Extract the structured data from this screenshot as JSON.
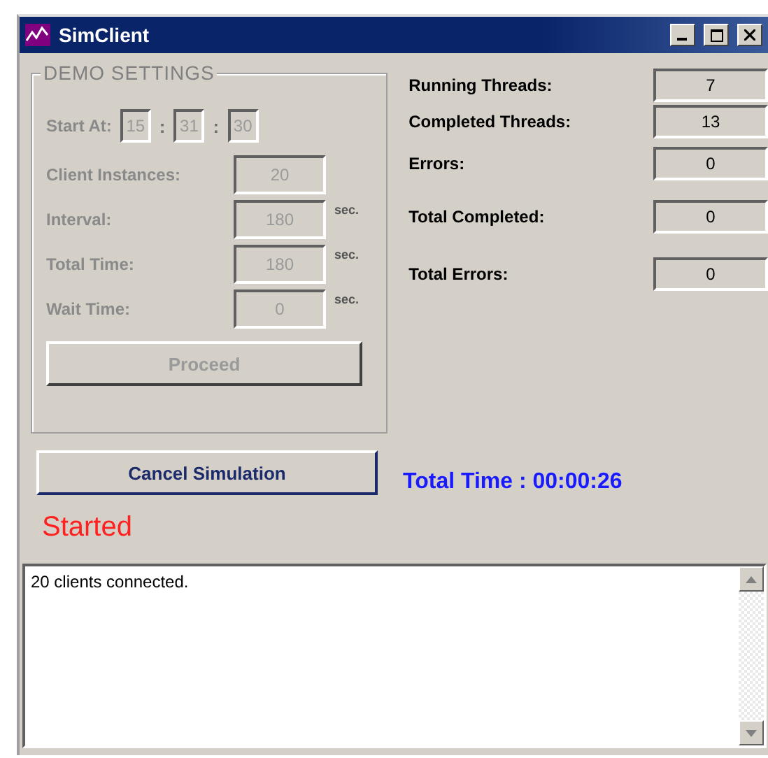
{
  "window": {
    "title": "SimClient"
  },
  "demo_settings": {
    "title": "DEMO SETTINGS",
    "disabled": true,
    "start_at": {
      "label": "Start At:",
      "hours": "15",
      "minutes": "31",
      "seconds": "30",
      "separators": [
        ":",
        ":"
      ]
    },
    "fields": [
      {
        "label": "Client Instances:",
        "value": "20"
      },
      {
        "label": "Interval:",
        "value": "180",
        "unit": "sec."
      },
      {
        "label": "Total Time:",
        "value": "180",
        "unit": "sec."
      },
      {
        "label": "Wait Time:",
        "value": "0",
        "unit": "sec."
      }
    ],
    "proceed_button": {
      "label": "Proceed",
      "disabled": true
    }
  },
  "stats": [
    {
      "label": "Running Threads:",
      "value": "7"
    },
    {
      "label": "Completed Threads:",
      "value": "13"
    },
    {
      "label": "Errors:",
      "value": "0"
    },
    {
      "label": "Total Completed:",
      "value": "0"
    },
    {
      "label": "Total Errors:",
      "value": "0"
    }
  ],
  "cancel_button": {
    "label": "Cancel Simulation"
  },
  "total_time": "Total Time : 00:00:26",
  "status": "Started",
  "log": [
    "20 clients connected."
  ]
}
